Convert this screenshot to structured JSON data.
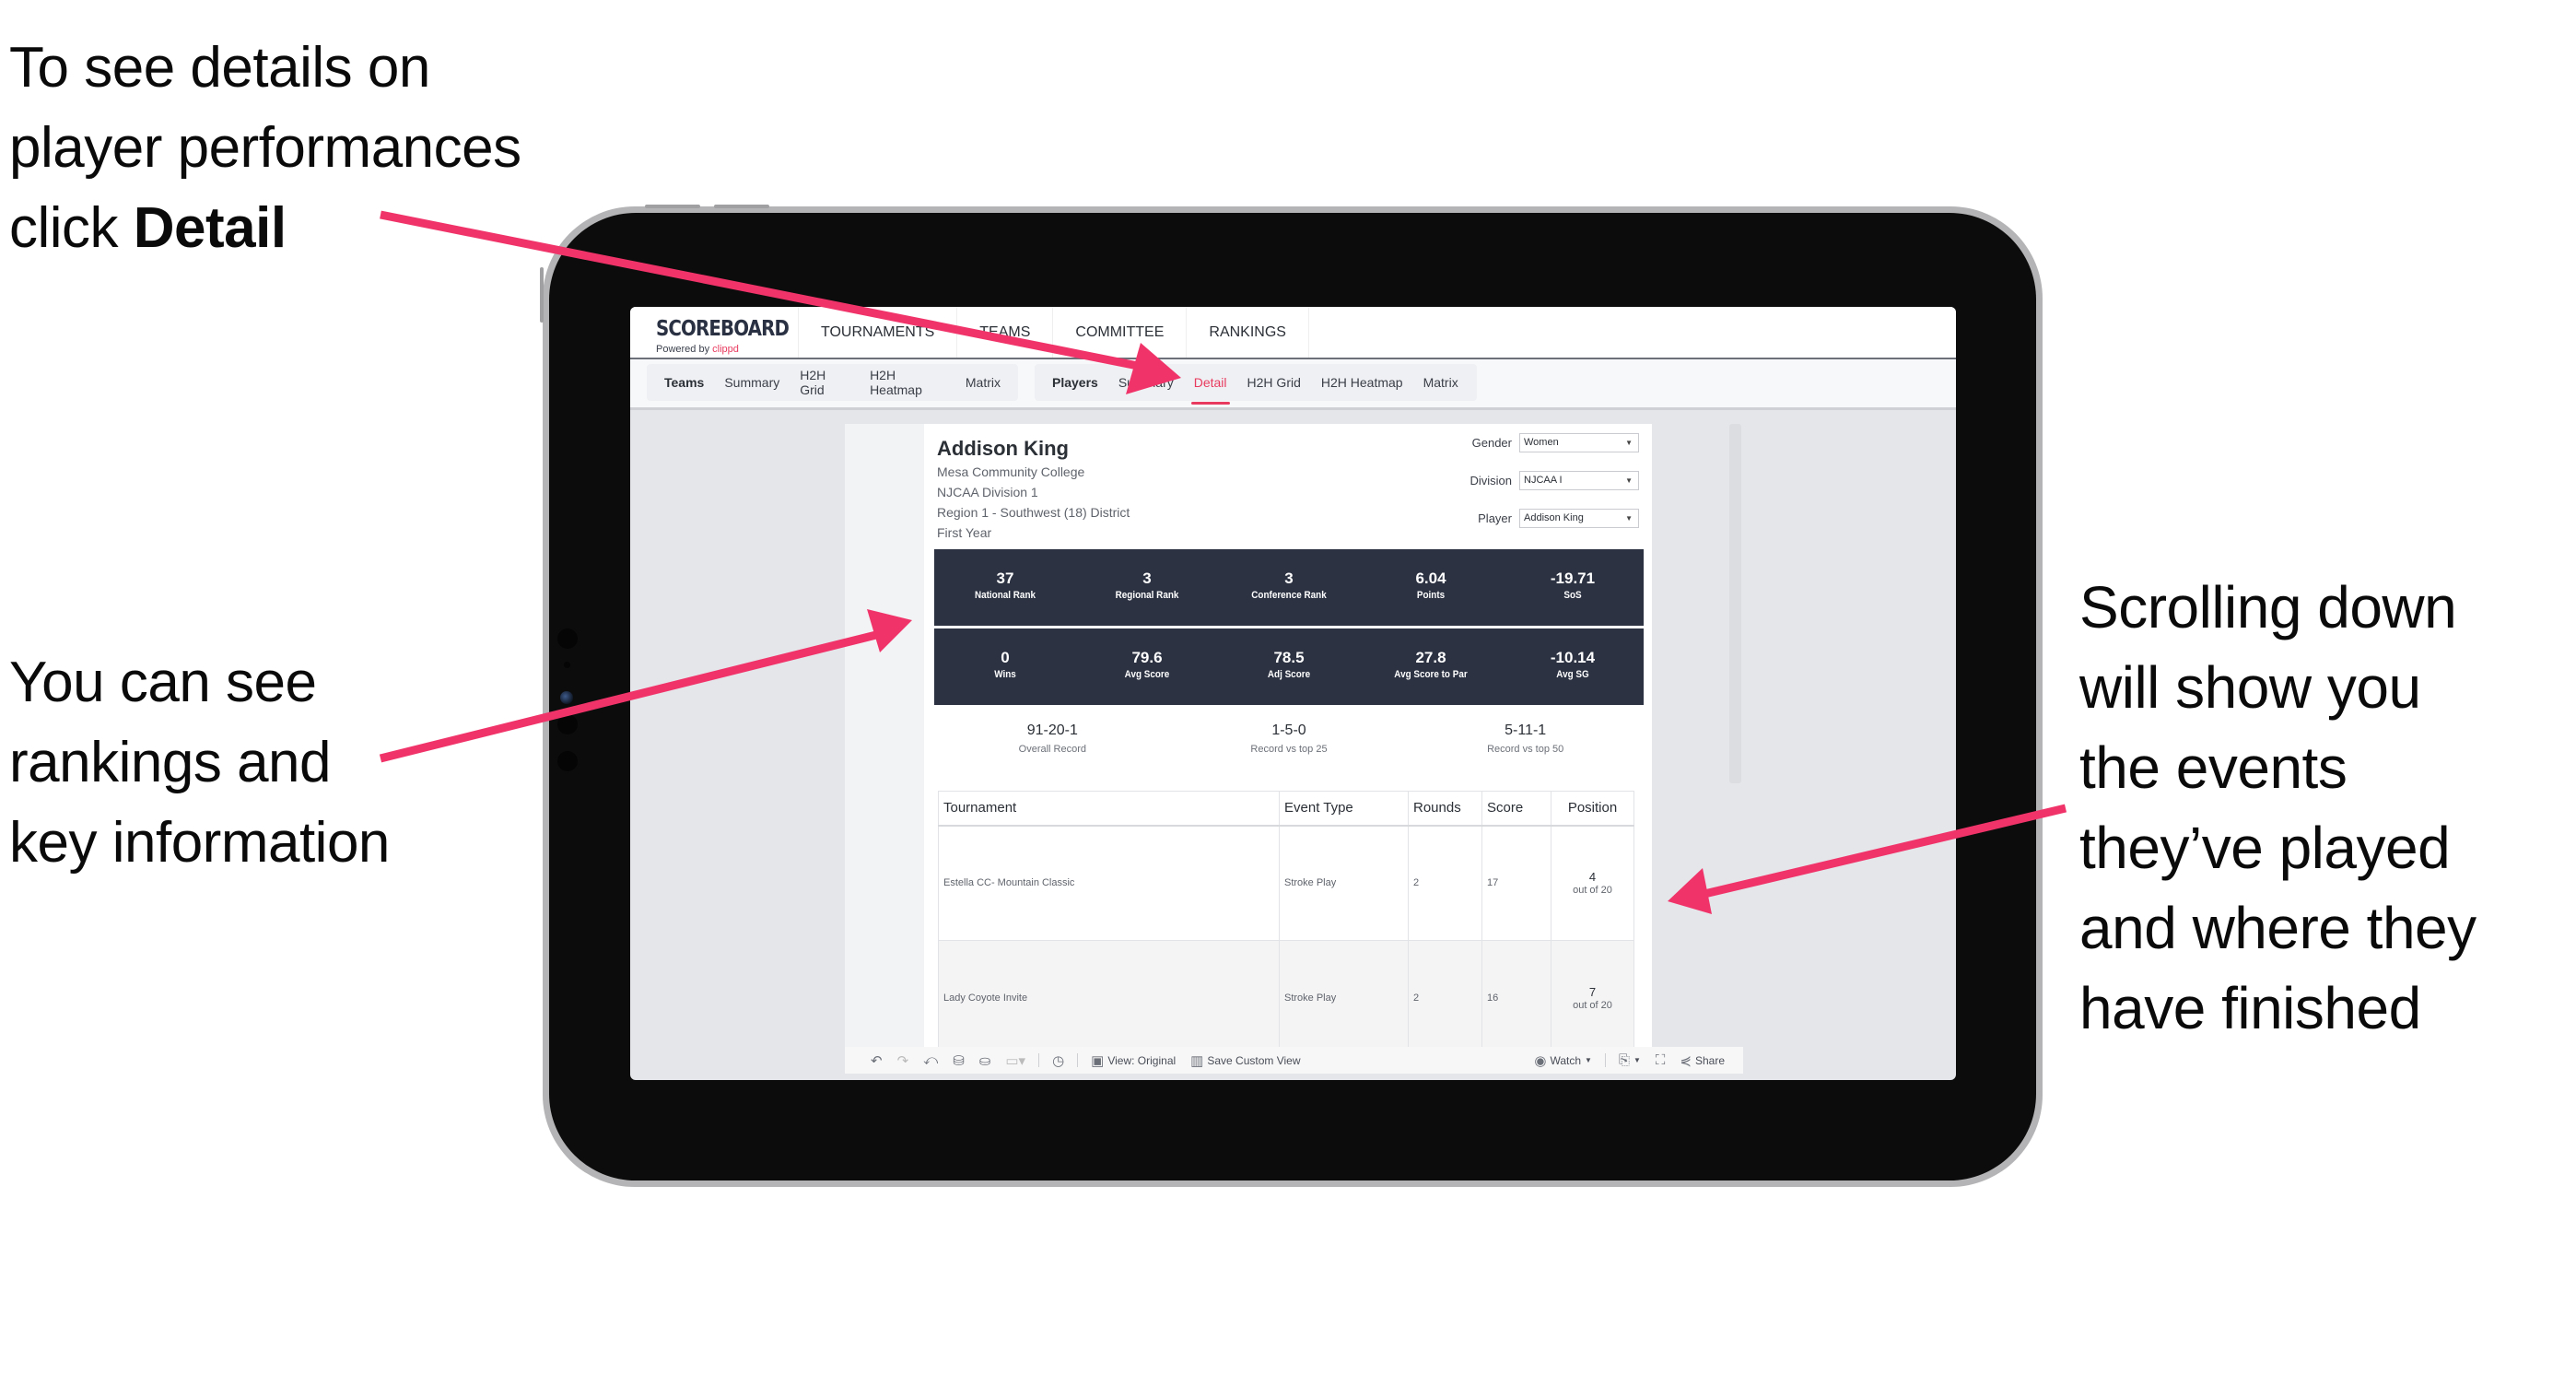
{
  "annotations": {
    "top": {
      "line1": "To see details on",
      "line2": "player performances",
      "line3_prefix": "click ",
      "line3_bold": "Detail"
    },
    "left": {
      "line1": "You can see",
      "line2": "rankings and",
      "line3": "key information"
    },
    "right": {
      "line1": "Scrolling down",
      "line2": "will show you",
      "line3": "the events",
      "line4": "they’ve played",
      "line5": "and where they",
      "line6": "have finished"
    },
    "arrow_color": "#f0346a"
  },
  "app": {
    "logo": {
      "title": "SCOREBOARD",
      "powered_by": "Powered by ",
      "brand": "clippd"
    },
    "top_nav": [
      "TOURNAMENTS",
      "TEAMS",
      "COMMITTEE",
      "RANKINGS"
    ],
    "teams_nav": [
      "Teams",
      "Summary",
      "H2H Grid",
      "H2H Heatmap",
      "Matrix"
    ],
    "players_nav": [
      "Players",
      "Summary",
      "Detail",
      "H2H Grid",
      "H2H Heatmap",
      "Matrix"
    ],
    "active_tab": "Detail",
    "accent_color": "#e83a5f"
  },
  "player": {
    "name": "Addison King",
    "school": "Mesa Community College",
    "division": "NJCAA Division 1",
    "region": "Region 1 - Southwest (18) District",
    "year": "First Year"
  },
  "filters": {
    "gender": {
      "label": "Gender",
      "value": "Women"
    },
    "division": {
      "label": "Division",
      "value": "NJCAA I"
    },
    "player": {
      "label": "Player",
      "value": "Addison King"
    }
  },
  "stats_row1": [
    {
      "value": "37",
      "label": "National Rank"
    },
    {
      "value": "3",
      "label": "Regional Rank"
    },
    {
      "value": "3",
      "label": "Conference Rank"
    },
    {
      "value": "6.04",
      "label": "Points"
    },
    {
      "value": "-19.71",
      "label": "SoS"
    }
  ],
  "stats_row2": [
    {
      "value": "0",
      "label": "Wins"
    },
    {
      "value": "79.6",
      "label": "Avg Score"
    },
    {
      "value": "78.5",
      "label": "Adj Score"
    },
    {
      "value": "27.8",
      "label": "Avg Score to Par"
    },
    {
      "value": "-10.14",
      "label": "Avg SG"
    }
  ],
  "records": [
    {
      "value": "91-20-1",
      "label": "Overall Record"
    },
    {
      "value": "1-5-0",
      "label": "Record vs top 25"
    },
    {
      "value": "5-11-1",
      "label": "Record vs top 50"
    }
  ],
  "events_table": {
    "columns": [
      "Tournament",
      "Event Type",
      "Rounds",
      "Score",
      "Position"
    ],
    "rows": [
      {
        "tournament": "Estella CC- Mountain Classic",
        "event_type": "Stroke Play",
        "rounds": "2",
        "score": "17",
        "position": "4",
        "field": "out of 20"
      },
      {
        "tournament": "Lady Coyote Invite",
        "event_type": "Stroke Play",
        "rounds": "2",
        "score": "16",
        "position": "7",
        "field": "out of 20"
      }
    ]
  },
  "toolbar": {
    "view_original": "View: Original",
    "save_custom_view": "Save Custom View",
    "watch": "Watch",
    "share": "Share"
  }
}
